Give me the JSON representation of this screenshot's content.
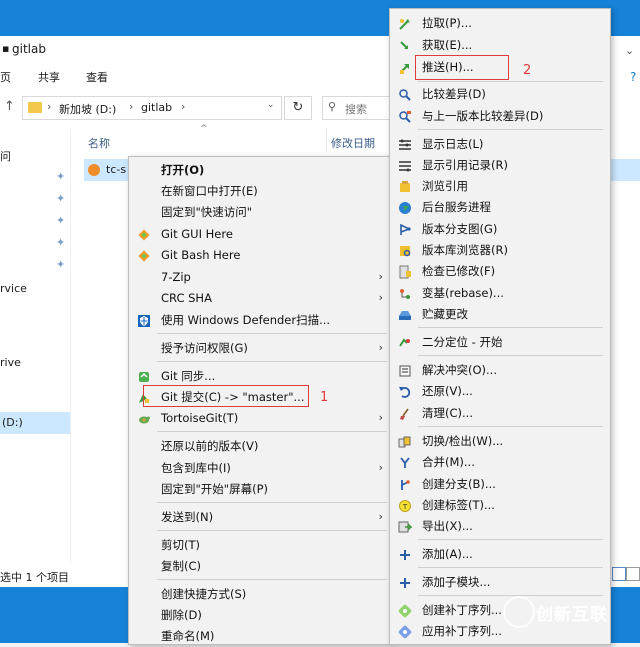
{
  "window": {
    "title": "gitlab",
    "ribbon_tabs": [
      "页",
      "共享",
      "查看"
    ],
    "breadcrumb": [
      "新加坡 (D:)",
      "gitlab"
    ],
    "search_placeholder": "搜索",
    "column_name": "名称",
    "column_modified": "修改日期",
    "file_name": "tc-s",
    "nav_items": [
      "问",
      "rvice",
      "rive",
      "(D:)"
    ],
    "status_text": "选中 1 个项目"
  },
  "menu1": {
    "items": [
      {
        "label": "打开(O)",
        "bold": true,
        "icon": "none"
      },
      {
        "label": "在新窗口中打开(E)",
        "icon": "none"
      },
      {
        "label": "固定到\"快速访问\"",
        "icon": "none"
      },
      {
        "label": "Git GUI Here",
        "icon": "git-diamond-icon"
      },
      {
        "label": "Git Bash Here",
        "icon": "git-diamond-icon"
      },
      {
        "label": "7-Zip",
        "icon": "none",
        "sub": true
      },
      {
        "label": "CRC SHA",
        "icon": "none",
        "sub": true
      },
      {
        "label": "使用 Windows Defender扫描...",
        "icon": "defender-shield-icon"
      },
      {
        "label": "授予访问权限(G)",
        "icon": "none",
        "sub": true
      },
      {
        "label": "Git 同步...",
        "icon": "git-sync-icon"
      },
      {
        "label": "Git 提交(C) -> \"master\"...",
        "icon": "git-commit-icon"
      },
      {
        "label": "TortoiseGit(T)",
        "icon": "tortoise-icon",
        "sub": true
      },
      {
        "label": "还原以前的版本(V)",
        "icon": "none"
      },
      {
        "label": "包含到库中(I)",
        "icon": "none",
        "sub": true
      },
      {
        "label": "固定到\"开始\"屏幕(P)",
        "icon": "none"
      },
      {
        "label": "发送到(N)",
        "icon": "none",
        "sub": true
      },
      {
        "label": "剪切(T)",
        "icon": "none"
      },
      {
        "label": "复制(C)",
        "icon": "none"
      },
      {
        "label": "创建快捷方式(S)",
        "icon": "none"
      },
      {
        "label": "删除(D)",
        "icon": "none"
      },
      {
        "label": "重命名(M)",
        "icon": "none"
      }
    ],
    "annotation_number": "1"
  },
  "menu2": {
    "items": [
      {
        "label": "拉取(P)...",
        "icon": "pull-icon"
      },
      {
        "label": "获取(E)...",
        "icon": "fetch-icon"
      },
      {
        "label": "推送(H)...",
        "icon": "push-icon"
      },
      {
        "label": "比较差异(D)",
        "icon": "diff-icon"
      },
      {
        "label": "与上一版本比较差异(D)",
        "icon": "diff-prev-icon"
      },
      {
        "label": "显示日志(L)",
        "icon": "log-icon"
      },
      {
        "label": "显示引用记录(R)",
        "icon": "reflog-icon"
      },
      {
        "label": "浏览引用",
        "icon": "browse-refs-icon"
      },
      {
        "label": "后台服务进程",
        "icon": "daemon-globe-icon"
      },
      {
        "label": "版本分支图(G)",
        "icon": "revision-graph-icon"
      },
      {
        "label": "版本库浏览器(R)",
        "icon": "repo-browser-icon"
      },
      {
        "label": "检查已修改(F)",
        "icon": "check-modified-icon"
      },
      {
        "label": "变基(rebase)...",
        "icon": "rebase-icon"
      },
      {
        "label": "贮藏更改",
        "icon": "stash-icon"
      },
      {
        "label": "二分定位 - 开始",
        "icon": "bisect-icon"
      },
      {
        "label": "解决冲突(O)...",
        "icon": "resolve-icon"
      },
      {
        "label": "还原(V)...",
        "icon": "revert-icon"
      },
      {
        "label": "清理(C)...",
        "icon": "cleanup-icon"
      },
      {
        "label": "切换/检出(W)...",
        "icon": "switch-icon"
      },
      {
        "label": "合并(M)...",
        "icon": "merge-icon"
      },
      {
        "label": "创建分支(B)...",
        "icon": "branch-icon"
      },
      {
        "label": "创建标签(T)...",
        "icon": "tag-icon"
      },
      {
        "label": "导出(X)...",
        "icon": "export-icon"
      },
      {
        "label": "添加(A)...",
        "icon": "add-icon"
      },
      {
        "label": "添加子模块...",
        "icon": "add-submodule-icon"
      },
      {
        "label": "创建补丁序列...",
        "icon": "create-patch-icon"
      },
      {
        "label": "应用补丁序列...",
        "icon": "apply-patch-icon"
      }
    ],
    "annotation_number": "2"
  },
  "watermark": "创新互联",
  "colors": {
    "accent_blue": "#1683d8",
    "menu_bg": "#f2f2f2",
    "annotation_red": "#e03b3b"
  }
}
